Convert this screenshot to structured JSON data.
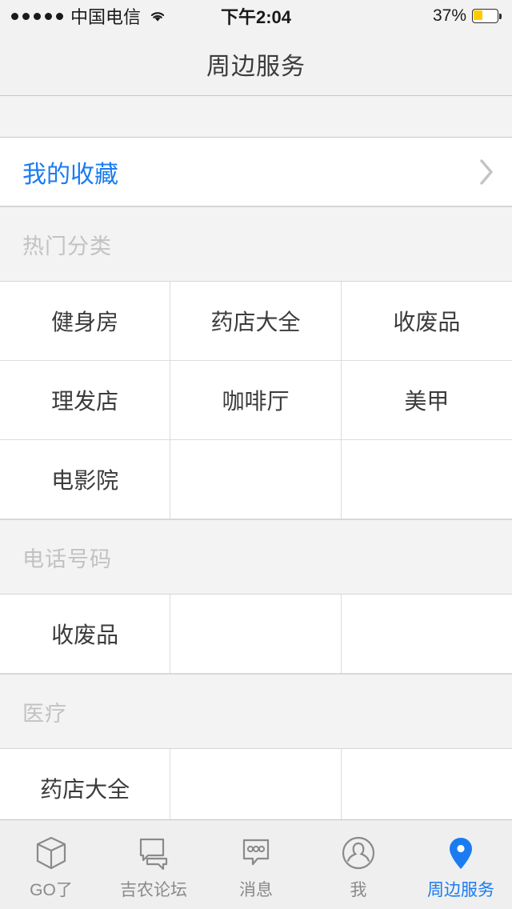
{
  "status_bar": {
    "signal_dots": 5,
    "carrier": "中国电信",
    "wifi_icon": "wifi-icon",
    "time": "下午2:04",
    "battery_percent": "37%",
    "battery_level": 37,
    "battery_color": "#ffcc00"
  },
  "navbar": {
    "title": "周边服务"
  },
  "favorites": {
    "label": "我的收藏",
    "accent_color": "#1a7cf0",
    "chevron_icon": "chevron-right-icon"
  },
  "sections": [
    {
      "id": "hot-categories",
      "title": "热门分类",
      "items": [
        "健身房",
        "药店大全",
        "收废品",
        "理发店",
        "咖啡厅",
        "美甲",
        "电影院"
      ]
    },
    {
      "id": "phone-numbers",
      "title": "电话号码",
      "items": [
        "收废品"
      ]
    },
    {
      "id": "medical",
      "title": "医疗",
      "items": [
        "药店大全"
      ]
    }
  ],
  "tabbar": {
    "active_index": 4,
    "active_color": "#1a7cf0",
    "inactive_color": "#8a8a8a",
    "tabs": [
      {
        "label": "GO了",
        "icon": "cube-icon"
      },
      {
        "label": "吉农论坛",
        "icon": "chat-bubbles-icon"
      },
      {
        "label": "消息",
        "icon": "message-dots-icon"
      },
      {
        "label": "我",
        "icon": "person-circle-icon"
      },
      {
        "label": "周边服务",
        "icon": "map-pin-icon"
      }
    ]
  }
}
